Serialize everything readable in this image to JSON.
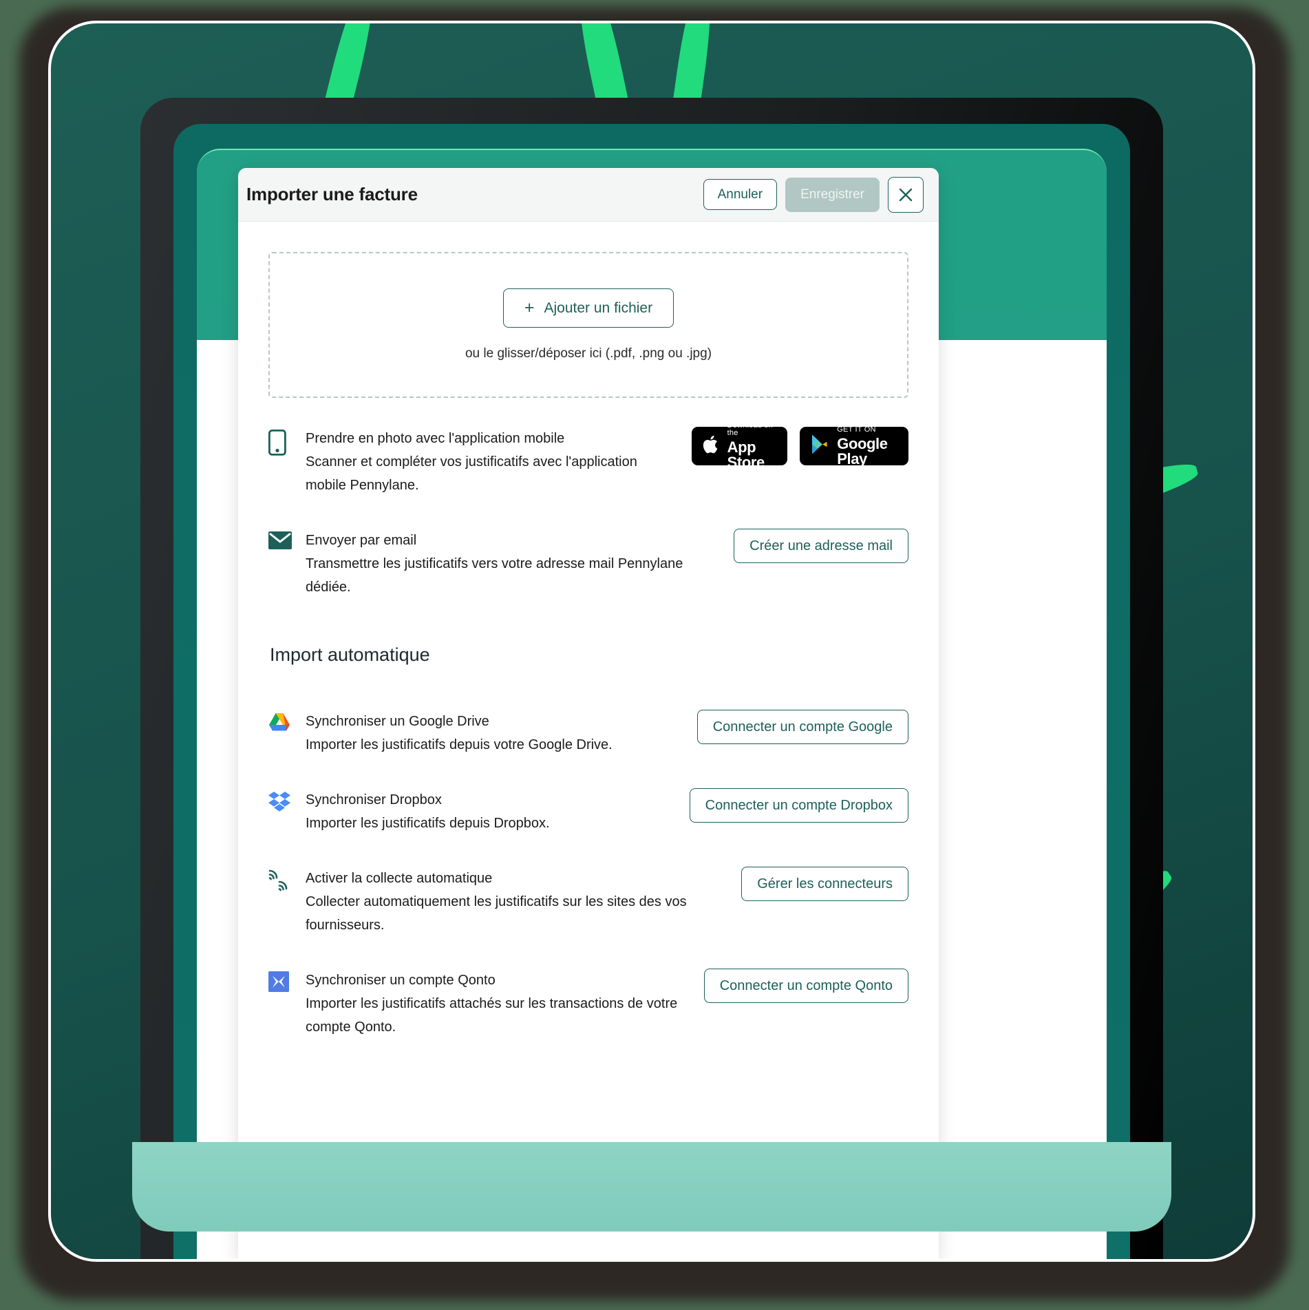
{
  "modal": {
    "title": "Importer une facture",
    "header_buttons": {
      "cancel": "Annuler",
      "save": "Enregistrer",
      "close_icon": "close-icon"
    },
    "dropzone": {
      "add_file_button": "Ajouter un fichier",
      "plus_icon": "+",
      "hint": "ou le glisser/déposer ici (.pdf, .png ou .jpg)"
    },
    "manual_options": [
      {
        "icon": "mobile-phone-icon",
        "title": "Prendre en photo avec l'application mobile",
        "description": "Scanner et compléter vos justificatifs avec l'application mobile Pennylane.",
        "store_badges": [
          {
            "icon": "apple-icon",
            "small": "Download on the",
            "big": "App Store"
          },
          {
            "icon": "google-play-icon",
            "small": "GET IT ON",
            "big": "Google Play"
          }
        ]
      },
      {
        "icon": "envelope-icon",
        "title": "Envoyer par email",
        "description": "Transmettre les justificatifs vers votre adresse mail Pennylane dédiée.",
        "action": "Créer une adresse mail"
      }
    ],
    "auto_import": {
      "section_title": "Import automatique",
      "options": [
        {
          "icon": "google-drive-icon",
          "title": "Synchroniser un Google Drive",
          "description": "Importer les justificatifs depuis votre Google Drive.",
          "action": "Connecter un compte Google"
        },
        {
          "icon": "dropbox-icon",
          "title": "Synchroniser Dropbox",
          "description": "Importer les justificatifs depuis Dropbox.",
          "action": "Connecter un compte Dropbox"
        },
        {
          "icon": "signal-waves-icon",
          "title": "Activer la collecte automatique",
          "description": "Collecter automatiquement les justificatifs sur les sites des vos fournisseurs.",
          "action": "Gérer les connecteurs"
        },
        {
          "icon": "qonto-icon",
          "title": "Synchroniser un compte Qonto",
          "description": "Importer les justificatifs attachés sur les transactions de votre compte Qonto.",
          "action": "Connecter un compte Qonto"
        }
      ]
    }
  },
  "colors": {
    "accent_teal": "#1d6059",
    "frame_teal": "#17524b",
    "frame_green": "#22a086",
    "stripe_green": "#22e37f",
    "disabled_gray": "#b1c7c3",
    "header_bg": "#f4f5f5",
    "qonto_blue": "#527ce3"
  }
}
